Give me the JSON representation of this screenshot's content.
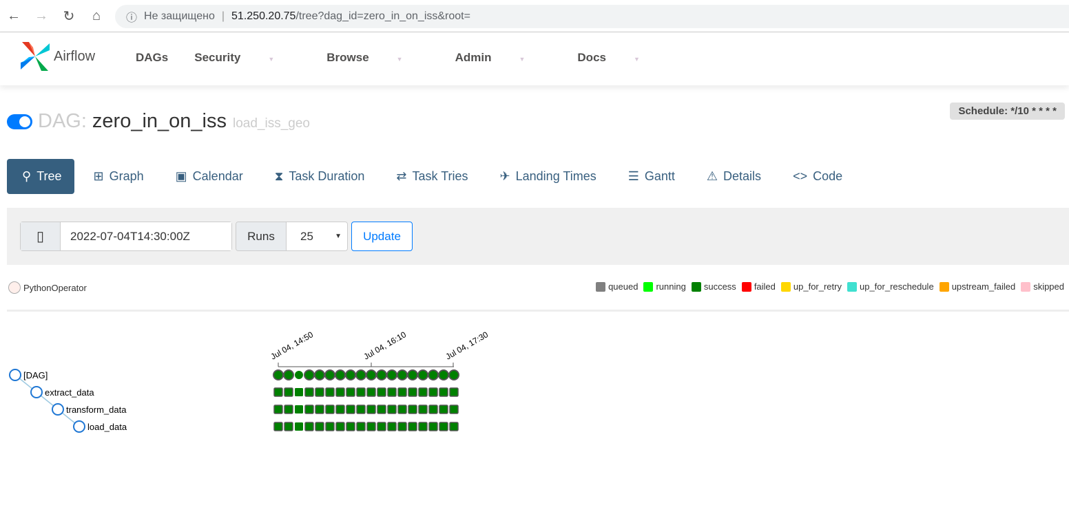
{
  "browser": {
    "security": "Не защищено",
    "host": "51.250.20.75",
    "path": "/tree?dag_id=zero_in_on_iss&root="
  },
  "nav": {
    "brand": "Airflow",
    "items": [
      "DAGs",
      "Security",
      "Browse",
      "Admin",
      "Docs"
    ]
  },
  "dag": {
    "label": "DAG:",
    "name": "zero_in_on_iss",
    "description": "load_iss_geo",
    "paused": false,
    "schedule": "Schedule: */10 * * * *"
  },
  "tabs": [
    {
      "label": "Tree",
      "icon": "tree-icon"
    },
    {
      "label": "Graph",
      "icon": "graph-icon"
    },
    {
      "label": "Calendar",
      "icon": "calendar-icon"
    },
    {
      "label": "Task Duration",
      "icon": "hourglass-icon"
    },
    {
      "label": "Task Tries",
      "icon": "repeat-icon"
    },
    {
      "label": "Landing Times",
      "icon": "plane-landing-icon"
    },
    {
      "label": "Gantt",
      "icon": "gantt-icon"
    },
    {
      "label": "Details",
      "icon": "warning-triangle-icon"
    },
    {
      "label": "Code",
      "icon": "code-icon"
    }
  ],
  "form": {
    "base_date": "2022-07-04T14:30:00Z",
    "runs_label": "Runs",
    "runs_value": "25",
    "update": "Update"
  },
  "operator": {
    "name": "PythonOperator",
    "color": "#ffefeb"
  },
  "states": [
    {
      "name": "queued",
      "color": "#808080"
    },
    {
      "name": "running",
      "color": "#00ff00"
    },
    {
      "name": "success",
      "color": "#008000"
    },
    {
      "name": "failed",
      "color": "#ff0000"
    },
    {
      "name": "up_for_retry",
      "color": "#ffd700"
    },
    {
      "name": "up_for_reschedule",
      "color": "#40e0d0"
    },
    {
      "name": "upstream_failed",
      "color": "#ffa500"
    },
    {
      "name": "skipped",
      "color": "#ffc0cb"
    }
  ],
  "tree": {
    "nodes": [
      "[DAG]",
      "extract_data",
      "transform_data",
      "load_data"
    ],
    "time_ticks": [
      "Jul 04, 14:50",
      "Jul 04, 16:10",
      "Jul 04, 17:30"
    ],
    "run_count": 18,
    "run_state": "success"
  }
}
